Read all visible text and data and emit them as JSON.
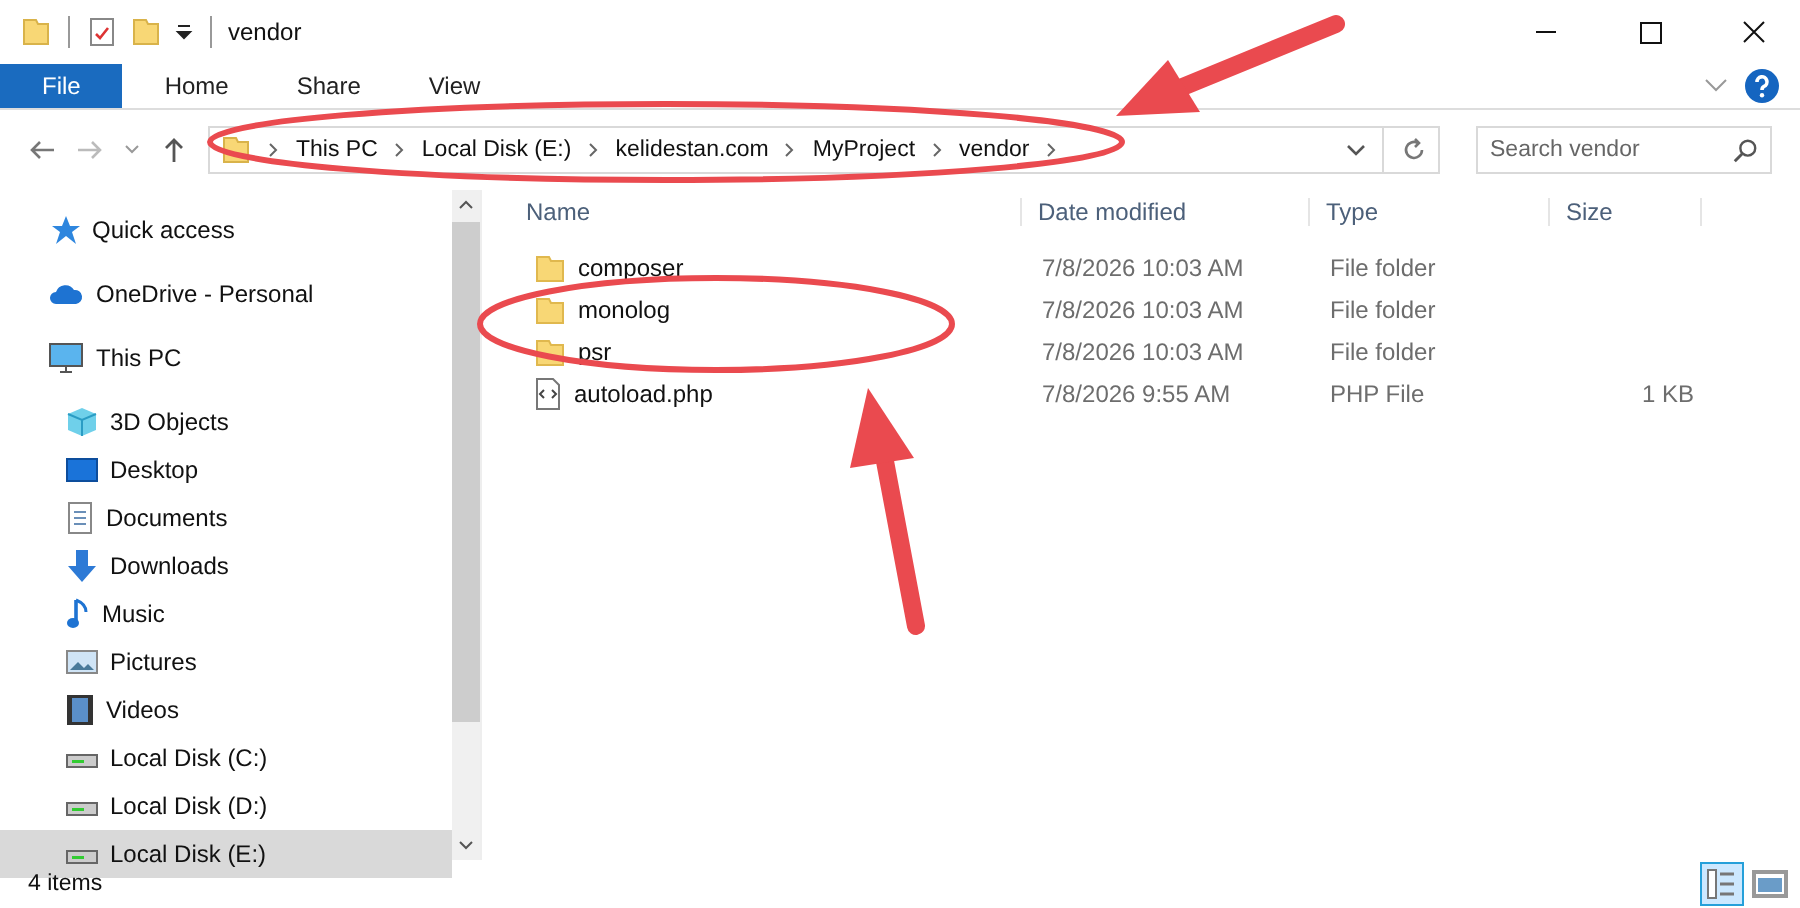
{
  "window": {
    "title": "vendor"
  },
  "ribbon_tabs": [
    {
      "label": "File",
      "selected": true
    },
    {
      "label": "Home",
      "selected": false
    },
    {
      "label": "Share",
      "selected": false
    },
    {
      "label": "View",
      "selected": false
    }
  ],
  "address_bar": {
    "path": [
      "This PC",
      "Local Disk (E:)",
      "kelidestan.com",
      "MyProject",
      "vendor"
    ]
  },
  "search": {
    "placeholder": "Search vendor"
  },
  "sidebar": {
    "items": [
      {
        "label": "Quick access",
        "kind": "star",
        "selected": false
      },
      {
        "label": "OneDrive - Personal",
        "kind": "cloud",
        "selected": false
      },
      {
        "label": "This PC",
        "kind": "pc",
        "selected": false,
        "children": [
          {
            "label": "3D Objects",
            "kind": "cube",
            "selected": false
          },
          {
            "label": "Desktop",
            "kind": "desktop",
            "selected": false
          },
          {
            "label": "Documents",
            "kind": "document",
            "selected": false
          },
          {
            "label": "Downloads",
            "kind": "download",
            "selected": false
          },
          {
            "label": "Music",
            "kind": "music",
            "selected": false
          },
          {
            "label": "Pictures",
            "kind": "pictures",
            "selected": false
          },
          {
            "label": "Videos",
            "kind": "video",
            "selected": false
          },
          {
            "label": "Local Disk (C:)",
            "kind": "drive",
            "selected": false
          },
          {
            "label": "Local Disk (D:)",
            "kind": "drive",
            "selected": false
          },
          {
            "label": "Local Disk (E:)",
            "kind": "drive",
            "selected": true
          }
        ]
      }
    ]
  },
  "table": {
    "columns": [
      "Name",
      "Date modified",
      "Type",
      "Size"
    ],
    "rows": [
      {
        "kind": "folder",
        "name": "composer",
        "date": "7/8/2026 10:03 AM",
        "type": "File folder"
      },
      {
        "kind": "folder",
        "name": "monolog",
        "date": "7/8/2026 10:03 AM",
        "type": "File folder"
      },
      {
        "kind": "folder",
        "name": "psr",
        "date": "7/8/2026 10:03 AM",
        "type": "File folder"
      },
      {
        "kind": "file",
        "name": "autoload.php",
        "date": "7/8/2026 9:55 AM",
        "type": "PHP File",
        "size": "1 KB"
      }
    ]
  },
  "status_bar": {
    "count": "4 items"
  }
}
